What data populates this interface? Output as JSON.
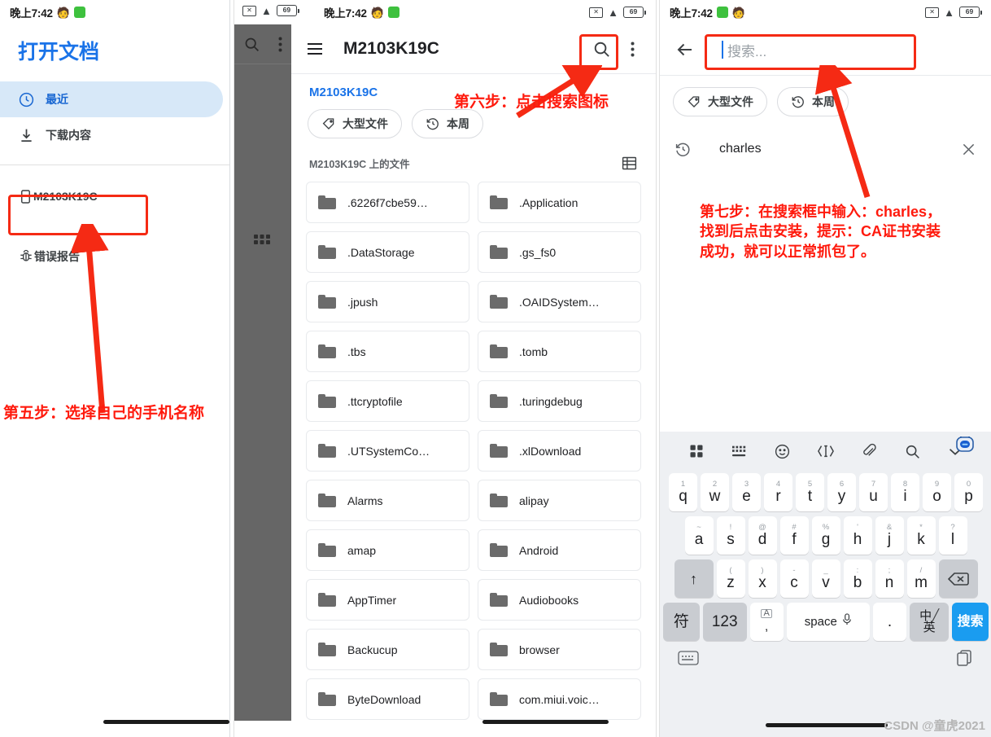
{
  "status_bar": {
    "time": "晚上7:42",
    "left_icons": [
      "emoji-person-icon",
      "green-app-icon"
    ],
    "right_icons": [
      "no-sim-icon",
      "wifi-icon",
      "battery-icon"
    ],
    "battery_level": "69"
  },
  "colors": {
    "accent_blue": "#1a73e8",
    "annotation_red": "#ff1a0d",
    "highlight_bg": "#d7e8f8",
    "overlay_gray": "#666666",
    "key_go_blue": "#1a9cf0"
  },
  "left_panel": {
    "title": "打开文档",
    "items": [
      {
        "label": "最近",
        "icon": "clock-icon",
        "active": true
      },
      {
        "label": "下载内容",
        "icon": "download-icon",
        "active": false
      }
    ],
    "device": {
      "label": "M2103K19C",
      "icon": "phone-icon"
    },
    "bug_item": {
      "label": "错误报告",
      "icon": "bug-icon"
    },
    "annotation": "第五步：选择自己的手机名称"
  },
  "mid_panel": {
    "overlay_icons": [
      "search-icon",
      "overflow-menu-icon",
      "apps-grid-icon"
    ],
    "appbar": {
      "menu_icon": "hamburger-menu-icon",
      "title": "M2103K19C",
      "search_icon": "search-icon",
      "overflow_icon": "overflow-menu-icon"
    },
    "breadcrumb": "M2103K19C",
    "chips": [
      {
        "label": "大型文件",
        "icon": "tag-icon"
      },
      {
        "label": "本周",
        "icon": "history-icon"
      }
    ],
    "section_label": "M2103K19C 上的文件",
    "view_toggle_icon": "list-view-icon",
    "files": [
      ".6226f7cbe59…",
      ".Application",
      ".DataStorage",
      ".gs_fs0",
      ".jpush",
      ".OAIDSystem…",
      ".tbs",
      ".tomb",
      ".ttcryptofile",
      ".turingdebug",
      ".UTSystemCo…",
      ".xlDownload",
      "Alarms",
      "alipay",
      "amap",
      "Android",
      "AppTimer",
      "Audiobooks",
      "Backucup",
      "browser",
      "ByteDownload",
      "com.miui.voic…"
    ],
    "annotation": "第六步：点击搜索图标"
  },
  "right_panel": {
    "back_icon": "back-arrow-icon",
    "search_placeholder": "搜索...",
    "search_value": "",
    "chips": [
      {
        "label": "大型文件",
        "icon": "tag-icon"
      },
      {
        "label": "本周",
        "icon": "history-icon"
      }
    ],
    "history": {
      "label": "charles",
      "icon": "history-icon",
      "remove_icon": "close-icon"
    },
    "annotation": "第七步：在搜索框中输入：charles，\n找到后点击安装，提示：CA证书安装\n成功，就可以正常抓包了。",
    "keyboard": {
      "toolbar_icons": [
        "apps-grid-icon",
        "keyboard-icon",
        "emoji-icon",
        "text-cursor-icon",
        "clipboard-icon",
        "search-icon",
        "chevron-down-icon"
      ],
      "row1": [
        {
          "sup": "1",
          "main": "q"
        },
        {
          "sup": "2",
          "main": "w"
        },
        {
          "sup": "3",
          "main": "e"
        },
        {
          "sup": "4",
          "main": "r"
        },
        {
          "sup": "5",
          "main": "t"
        },
        {
          "sup": "6",
          "main": "y"
        },
        {
          "sup": "7",
          "main": "u"
        },
        {
          "sup": "8",
          "main": "i"
        },
        {
          "sup": "9",
          "main": "o"
        },
        {
          "sup": "0",
          "main": "p"
        }
      ],
      "row2": [
        {
          "sup": "~",
          "main": "a"
        },
        {
          "sup": "!",
          "main": "s"
        },
        {
          "sup": "@",
          "main": "d"
        },
        {
          "sup": "#",
          "main": "f"
        },
        {
          "sup": "%",
          "main": "g"
        },
        {
          "sup": "'",
          "main": "h"
        },
        {
          "sup": "&",
          "main": "j"
        },
        {
          "sup": "*",
          "main": "k"
        },
        {
          "sup": "?",
          "main": "l"
        }
      ],
      "row3": [
        {
          "sup": "(",
          "main": "z"
        },
        {
          "sup": ")",
          "main": "x"
        },
        {
          "sup": "-",
          "main": "c"
        },
        {
          "sup": "_",
          "main": "v"
        },
        {
          "sup": ":",
          "main": "b"
        },
        {
          "sup": ";",
          "main": "n"
        },
        {
          "sup": "/",
          "main": "m"
        }
      ],
      "shift_label": "↑",
      "backspace_icon": "backspace-icon",
      "row4": [
        {
          "label": "符"
        },
        {
          "label": "123"
        },
        {
          "label": ","
        },
        {
          "label": "space"
        },
        {
          "label": "."
        },
        {
          "label": "中/英"
        },
        {
          "label": "搜索"
        }
      ],
      "mic_icon": "microphone-icon",
      "foot_left_icon": "keyboard-switch-icon",
      "foot_right_icon": "clipboard-copy-icon",
      "ime_badge_icon": "ime-robot-icon"
    }
  },
  "watermark": "CSDN @童虎2021"
}
